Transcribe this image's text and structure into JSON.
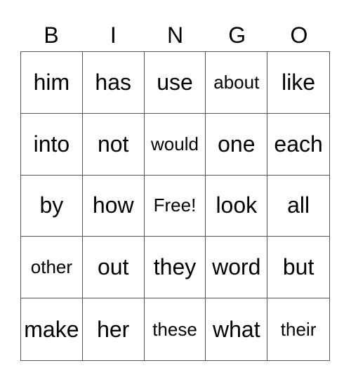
{
  "header": [
    "B",
    "I",
    "N",
    "G",
    "O"
  ],
  "rows": [
    [
      "him",
      "has",
      "use",
      "about",
      "like"
    ],
    [
      "into",
      "not",
      "would",
      "one",
      "each"
    ],
    [
      "by",
      "how",
      "Free!",
      "look",
      "all"
    ],
    [
      "other",
      "out",
      "they",
      "word",
      "but"
    ],
    [
      "make",
      "her",
      "these",
      "what",
      "their"
    ]
  ]
}
